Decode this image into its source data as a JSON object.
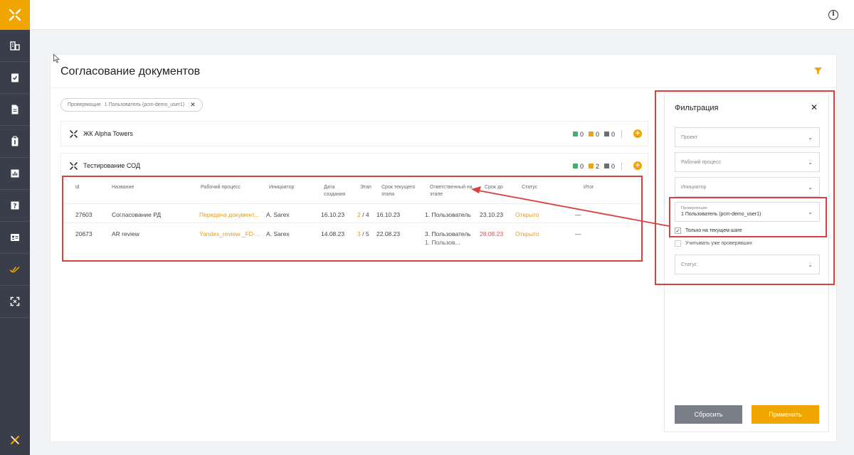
{
  "sidebar": {
    "items": [
      {
        "icon": "buildings-icon"
      },
      {
        "icon": "clipboard-check-icon"
      },
      {
        "icon": "document-icon"
      },
      {
        "icon": "clipboard-icon"
      },
      {
        "icon": "bar-chart-icon"
      },
      {
        "icon": "help-icon"
      },
      {
        "icon": "id-card-icon"
      },
      {
        "icon": "double-check-icon",
        "active": true
      },
      {
        "icon": "expand-icon"
      }
    ],
    "accent": "#f0a500"
  },
  "page": {
    "title": "Согласование документов"
  },
  "filter_chip": {
    "label": "Проверяющие",
    "value": "1 Пользователь (pcm-demo_user1)"
  },
  "projects": [
    {
      "name": "ЖК Alpha Towers",
      "stats": {
        "green": "0",
        "orange": "0",
        "gray": "0"
      }
    },
    {
      "name": "Тестирование СОД",
      "stats": {
        "green": "0",
        "orange": "2",
        "gray": "0"
      }
    }
  ],
  "table": {
    "headers": {
      "id": "id",
      "name": "Название",
      "process": "Рабочий процесс",
      "initiator": "Инициатор",
      "created": "Дата создания",
      "stage": "Этап",
      "stage_due": "Срок текущего этапа",
      "responsible": "Ответственный на этапе",
      "due": "Срок до",
      "status": "Статус",
      "result": "Итог"
    },
    "rows": [
      {
        "id": "27603",
        "name": "Согласование РД",
        "process": "Передача документ...",
        "initiator": "A. Sarex",
        "created": "16.10.23",
        "stage_cur": "2",
        "stage_total": "/ 4",
        "stage_due": "16.10.23",
        "responsible": "1. Пользователь",
        "responsible2": "",
        "due": "23.10.23",
        "status": "Открыто",
        "result": "—"
      },
      {
        "id": "20673",
        "name": "AR review",
        "process": "Yandex_review _FD-...",
        "initiator": "A. Sarex",
        "created": "14.08.23",
        "stage_cur": "3",
        "stage_total": "/ 5",
        "stage_due": "22.08.23",
        "responsible": "3. Пользователь",
        "responsible2": "1. Пользов...",
        "due": "28.08.23",
        "status": "Открыто",
        "result": "—"
      }
    ]
  },
  "filter_panel": {
    "title": "Фильтрация",
    "project_placeholder": "Проект",
    "process_placeholder": "Рабочий процесс",
    "initiator_placeholder": "Инициатор",
    "reviewers_label": "Проверяющие",
    "reviewers_value": "1 Пользователь (pcm-demo_user1)",
    "only_current_step": "Только на текущем шаге",
    "include_checked": "Учитывать уже проверявших",
    "status_placeholder": "Статус",
    "reset_label": "Сбросить",
    "apply_label": "Применить"
  },
  "colors": {
    "green": "#3cb46e",
    "orange": "#f0a500",
    "gray": "#6b6e78",
    "annotation_red": "#d94040"
  }
}
